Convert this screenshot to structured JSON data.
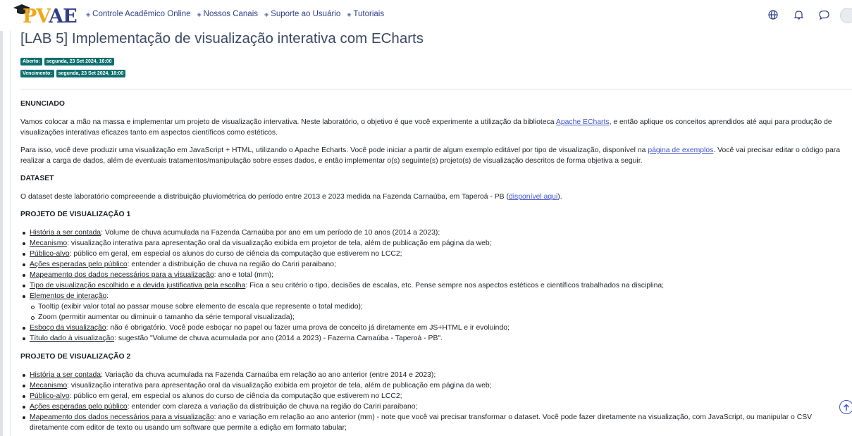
{
  "brand": {
    "logo_text_1": "PV",
    "logo_text_2": "AE"
  },
  "nav": {
    "links": [
      {
        "label": "Controle Acadêmico Online"
      },
      {
        "label": "Nossos Canais"
      },
      {
        "label": "Suporte ao Usuário"
      },
      {
        "label": "Tutoriais"
      }
    ],
    "icons": [
      "globe-icon",
      "bell-icon",
      "chat-icon",
      "user-avatar"
    ]
  },
  "page": {
    "title": "[LAB 5] Implementação de visualização interativa com ECharts",
    "opened_label": "Aberto:",
    "opened_value": "segunda, 23 Set 2024, 16:00",
    "due_label": "Vencimento:",
    "due_value": "segunda, 23 Set 2024, 18:00"
  },
  "content": {
    "enunciado_heading": "ENUNCIADO",
    "p1_a": "Vamos colocar a mão na massa e implementar um projeto de visualização intervativa. Neste laboratório, o objetivo é que você experimente a utilização da biblioteca ",
    "p1_link": "Apache ECharts",
    "p1_b": ", e então aplique os conceitos aprendidos até aqui para produção de visualizações interativas eficazes tanto em aspectos científicos como estéticos.",
    "p2_a": "Para isso, você deve produzir uma visualização em JavaScript + HTML, utilizando o Apache Echarts. Você pode iniciar a partir de algum exemplo editável por tipo de visualização, disponível na ",
    "p2_link": "página de exemplos",
    "p2_b": ". Você vai precisar editar o código para realizar a carga de dados, além de eventuais tratamentos/manipulação sobre esses dados, e então implementar o(s) seguinte(s) projeto(s) de visualização descritos de forma objetiva a seguir.",
    "dataset_heading": "DATASET",
    "p3_a": "O dataset deste laboratório compreeende a distribuição pluviométrica do período entre 2013 e 2023 medida na Fazenda Carnaúba, em Taperoá - PB (",
    "p3_link": "disponível aqui",
    "p3_b": ").",
    "proj1_heading": "PROJETO DE VISUALIZAÇÃO 1",
    "proj1": [
      {
        "term": "História a ser contada",
        "text": ": Volume de chuva acumulada na Fazenda Carnaúba por ano em um período de 10 anos (2014 a 2023);"
      },
      {
        "term": "Mecanismo",
        "text": ": visualização interativa para apresentação oral da visualização exibida em projetor de tela, além de publicação em página da web;"
      },
      {
        "term": "Público-alvo",
        "text": ": público em geral, em especial os alunos do curso de ciência da computação que estiverem no LCC2;"
      },
      {
        "term": "Ações esperadas pelo público",
        "text": ": entender a distribuição de chuva na região do Cariri paraibano;"
      },
      {
        "term": "Mapeamento dos dados necessários para a visualização",
        "text": ": ano e total (mm);"
      },
      {
        "term": "Tipo de visualização escolhido e a devida justificativa pela escolha",
        "text": ": Fica a seu critério o tipo, decisões de escalas, etc. Pense sempre nos aspectos estéticos e científicos trabalhados na disciplina;"
      },
      {
        "term": "Elementos de interação",
        "text": ":"
      },
      {
        "term": "Esboço da visualização",
        "text": ": não é obrigatório. Você pode esboçar no papel ou fazer uma prova de conceito já diretamente em JS+HTML e ir evoluindo;"
      },
      {
        "term": "Título dado à visualização",
        "text": ": sugestão \"Volume de chuva acumulada por ano (2014 a 2023) - Fazerna Carnaúba - Taperoá - PB\"."
      }
    ],
    "proj1_sub": [
      "Tooltip (exibir valor total ao passar mouse sobre elemento de escala que represente o total medido);",
      "Zoom (permitir aumentar ou diminuir o tamanho da série temporal visualizada);"
    ],
    "proj2_heading": "PROJETO DE VISUALIZAÇÃO 2",
    "proj2": [
      {
        "term": "História a ser contada",
        "text": ": Variação da chuva acumulada na Fazenda Carnaúba em relação ao ano anterior (entre 2014 e 2023);"
      },
      {
        "term": "Mecanismo",
        "text": ": visualização interativa para apresentação oral da visualização exibida em projetor de tela, além de publicação em página da web;"
      },
      {
        "term": "Público-alvo",
        "text": ": público em geral, em especial os alunos do curso de ciência da computação que estiverem no LCC2;"
      },
      {
        "term": "Ações esperadas pelo público",
        "text": ": entender com clareza a variação da distribuição de chuva na região do Cariri paraibano;"
      },
      {
        "term": "Mapeamento dos dados necessários para a visualização",
        "text": ": ano e variação em relação ao ano anterior (mm) - note que você vai precisar transformar o dataset. Você pode fazer diretamente na visualização, com JavaScript, ou manipular o CSV diretamente com editor de texto ou usando um software que permite a edição em formato tabular;"
      }
    ]
  }
}
